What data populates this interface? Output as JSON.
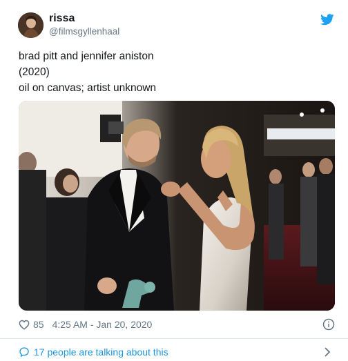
{
  "user": {
    "display_name": "rissa",
    "handle": "@filmsgyllenhaal"
  },
  "tweet": {
    "lines": [
      "brad pitt and jennifer aniston",
      "(2020)",
      "oil on canvas; artist unknown"
    ]
  },
  "footer": {
    "likes": "85",
    "timestamp": "4:25 AM - Jan 20, 2020",
    "talking": "17 people are talking about this"
  },
  "icons": {
    "brand": "twitter-bird-icon",
    "like": "heart-icon",
    "info": "info-icon",
    "conversation": "speech-bubble-icon",
    "more": "chevron-right-icon"
  },
  "colors": {
    "brand": "#1da1f2",
    "link": "#1b95e0",
    "muted": "#657786"
  }
}
